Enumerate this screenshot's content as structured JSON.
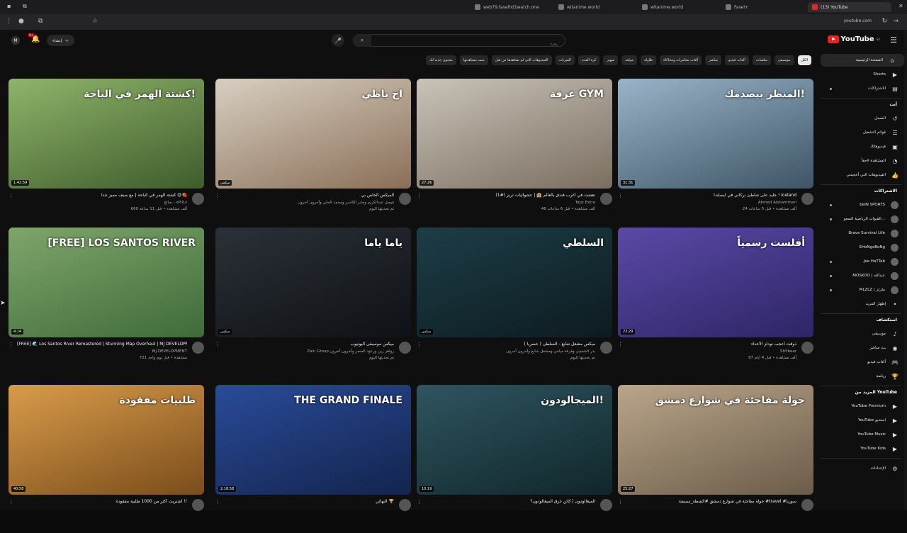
{
  "browser": {
    "tabs": [
      {
        "title": "web79.faselhd1watch.one"
      },
      {
        "title": "witanime.world"
      },
      {
        "title": "witanime.world"
      },
      {
        "title": "Fasel+"
      },
      {
        "title": "(13) YouTube"
      }
    ],
    "url": "youtube.com"
  },
  "header": {
    "logo_text": "YouTube",
    "logo_sup": "SA",
    "search_placeholder": "بحث",
    "create_label": "إنشاء",
    "notif_count": "9+",
    "account_initial": "M"
  },
  "chips": [
    "الكل",
    "موسيقى",
    "مكسات",
    "ألعاب فيديو",
    "مباشر",
    "ألعاب مغامرات ومحاكاة",
    "طاولة",
    "مولعة",
    "شهير",
    "كرة القدم",
    "الفيزيات",
    "الفيديوهات التي لم تشاهدها من قبل",
    "تمت مشاهدتها",
    "محتوى جديد لك"
  ],
  "videos": [
    {
      "title": "جليد على شاطئ بركاني في آيسلندا ! Iceland",
      "channel": "Ahmed Alshammari",
      "stats": "24 ألف مشاهدة • قبل 5 ساعات",
      "duration": "31:31",
      "thumb_text": "المنظر بيصدمك!",
      "colors": [
        "#9ab3c8",
        "#3d5566"
      ]
    },
    {
      "title": "تعشت في أغرب فندق بالعالم 🏨 | عشوائيات تريز (#1)",
      "channel": "Topz Extra",
      "stats": "46 ألف مشاهدة • قبل 6 ساعات",
      "duration": "27:26",
      "thumb_text": "غرفة GYM",
      "colors": [
        "#c9c3b8",
        "#7a6e60"
      ]
    },
    {
      "title": "الميكس الخاص بي",
      "channel": "فيصل عبدالكريم وجابر الكاسر ومحمد الحلي وآخرون آخرون",
      "stats": "تم تحديثها اليوم",
      "duration": "ميكس",
      "thumb_text": "اخ ياظي",
      "colors": [
        "#d8cfc1",
        "#8a6f58"
      ]
    },
    {
      "title": "كشتة الهمر في الباحة | مع ضيف مميز جداً 😍🍓",
      "channel": "صالح - oPiiLz",
      "stats": "660 ألف مشاهدة • قبل 11 ساعة",
      "duration": "1:42:59",
      "thumb_text": "كشتة الهمر في الباحة!",
      "colors": [
        "#8fb46a",
        "#3f5c2c"
      ]
    },
    {
      "title": "ذوقت أعجب نودلز الأعداء",
      "channel": "Sh5bear",
      "stats": "87 ألف مشاهدة • قبل 4 أيام",
      "duration": "23:29",
      "thumb_text": "أفلست رسمياً",
      "colors": [
        "#5b49a6",
        "#2d2566"
      ]
    },
    {
      "title": "ميكس مشعل شايع - السلطى ( حسرياً )",
      "channel": "بدر الشعيبي وفرقة ميامي ومشعل شايع وآخرون آخرون",
      "stats": "تم تحديثها اليوم",
      "duration": "ميكس",
      "thumb_text": "السلطي",
      "colors": [
        "#1d3d47",
        "#0d1b20"
      ]
    },
    {
      "title": "ميكس موسيقى اليوتيوب",
      "channel": "Zain Group رواهر زين ورعود الحصر وآخرون آخرون",
      "stats": "تم تحديثها اليوم",
      "duration": "ميكس",
      "thumb_text": "ياما ياما",
      "colors": [
        "#2b3138",
        "#0e1115"
      ]
    },
    {
      "title": "[FREE] 🌊 Los Santos River Remastered | Stunning Map Overhaul | MJ DEVELOPMENT",
      "channel": "MJ DEVELOPMENT",
      "stats": "721 مشاهدة • قبل يوم واحد",
      "duration": "4:14",
      "thumb_text": "[FREE] LOS SANTOS RIVER",
      "colors": [
        "#7fa56b",
        "#3e6b3a"
      ]
    },
    {
      "title": "جولة مفاجئة في شوارع دمشق #الشطة_سينيفة #travel #سوريا",
      "channel": "",
      "stats": "",
      "duration": "25:27",
      "thumb_text": "جولة مفاجئة في شوارع دمشق",
      "colors": [
        "#b9a58a",
        "#6b5c49"
      ]
    },
    {
      "title": "الميغالودون | كائن غرق الميغالودون؟",
      "channel": "",
      "stats": "",
      "duration": "10:19",
      "thumb_text": "الميجالودون!",
      "colors": [
        "#2f5560",
        "#10262b"
      ]
    },
    {
      "title": "النهائي 🏆",
      "channel": "",
      "stats": "",
      "duration": "2:18:58",
      "thumb_text": "THE GRAND FINALE",
      "colors": [
        "#2a4b9a",
        "#13244d"
      ]
    },
    {
      "title": "اشتريت أكثر من 1000 طلبية مفقودة !!",
      "channel": "",
      "stats": "",
      "duration": "40:58",
      "thumb_text": "طلبيات مفقودة",
      "colors": [
        "#d99b4a",
        "#7a4d1b"
      ]
    }
  ],
  "sidebar": {
    "main": [
      {
        "label": "الصفحة الرئيسية",
        "icon": "home-icon"
      },
      {
        "label": "Shorts",
        "icon": "shorts-icon"
      },
      {
        "label": "الاشتراكات",
        "icon": "subscriptions-icon"
      }
    ],
    "you_header": "أنت",
    "you": [
      {
        "label": "السجل",
        "icon": "history-icon"
      },
      {
        "label": "قوائم التشغيل",
        "icon": "playlist-icon"
      },
      {
        "label": "فيديوهاتك",
        "icon": "video-icon"
      },
      {
        "label": "المشاهدة لاحقاً",
        "icon": "clock-icon"
      },
      {
        "label": "الفيديوهات التي أعجبتني",
        "icon": "like-icon"
      }
    ],
    "subs_header": "الاشتراكات",
    "subs": [
      {
        "label": "beIN SPORTS",
        "dot": true
      },
      {
        "label": "القنوات الرياضية السعو...",
        "dot": true
      },
      {
        "label": "Brave Survival Life",
        "dot": false
      },
      {
        "label": "SHoNgxBoNg",
        "dot": false
      },
      {
        "label": "Joe HaTTab",
        "dot": true
      },
      {
        "label": "MOSKOO | عبدالله",
        "dot": true
      },
      {
        "label": "MLZLZ | ملزلز",
        "dot": true
      },
      {
        "label": "إظهار المزيد",
        "dot": false
      }
    ],
    "explore_header": "استكشاف",
    "explore": [
      {
        "label": "موسيقى",
        "icon": "music-icon"
      },
      {
        "label": "بث مباشر",
        "icon": "live-icon"
      },
      {
        "label": "ألعاب فيديو",
        "icon": "gaming-icon"
      },
      {
        "label": "رياضة",
        "icon": "trophy-icon"
      }
    ],
    "more_header": "المزيد من YouTube",
    "more": [
      {
        "label": "YouTube Premium"
      },
      {
        "label": "YouTube استديو"
      },
      {
        "label": "YouTube Music"
      },
      {
        "label": "YouTube Kids"
      }
    ],
    "settings": "الإعدادات"
  }
}
